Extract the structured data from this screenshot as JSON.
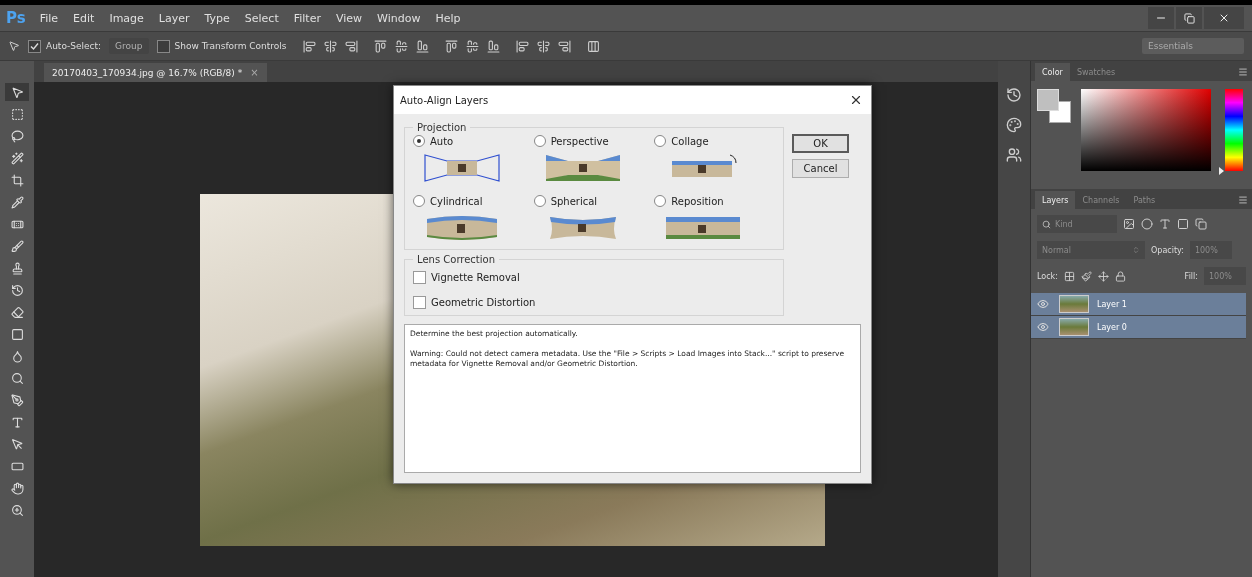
{
  "app": {
    "logo": "Ps"
  },
  "menu": [
    "File",
    "Edit",
    "Image",
    "Layer",
    "Type",
    "Select",
    "Filter",
    "View",
    "Window",
    "Help"
  ],
  "options_bar": {
    "auto_select": {
      "label": "Auto-Select:",
      "checked": true
    },
    "target": {
      "value": "Group",
      "disabled": true
    },
    "show_transform_controls": {
      "label": "Show Transform Controls",
      "checked": false
    },
    "workspace": "Essentials"
  },
  "document_tab": {
    "title": "20170403_170934.jpg @ 16.7% (RGB/8) *",
    "close": "×"
  },
  "color_panel": {
    "tabs": [
      {
        "label": "Color",
        "selected": true
      },
      {
        "label": "Swatches",
        "selected": false
      }
    ],
    "hue": {
      "level": 0
    }
  },
  "layers_panel": {
    "tabs": [
      {
        "label": "Layers",
        "selected": true
      },
      {
        "label": "Channels",
        "selected": false
      },
      {
        "label": "Paths",
        "selected": false
      }
    ],
    "filter": "Kind",
    "blend_mode": "Normal",
    "opacity_label": "Opacity:",
    "opacity": "100%",
    "lock_label": "Lock:",
    "fill_label": "Fill:",
    "fill": "100%",
    "layers": [
      {
        "name": "Layer 1",
        "visible": true,
        "selected": true
      },
      {
        "name": "Layer 0",
        "visible": true,
        "selected": true
      }
    ]
  },
  "dialog": {
    "title": "Auto-Align Layers",
    "projection": {
      "legend": "Projection",
      "options": [
        {
          "label": "Auto",
          "kind": "auto",
          "selected": true
        },
        {
          "label": "Perspective",
          "kind": "perspective",
          "selected": false
        },
        {
          "label": "Collage",
          "kind": "collage",
          "selected": false
        },
        {
          "label": "Cylindrical",
          "kind": "cylindrical",
          "selected": false
        },
        {
          "label": "Spherical",
          "kind": "spherical",
          "selected": false
        },
        {
          "label": "Reposition",
          "kind": "reposition",
          "selected": false
        }
      ]
    },
    "lens_correction": {
      "legend": "Lens Correction",
      "options": [
        {
          "label": "Vignette Removal",
          "checked": false
        },
        {
          "label": "Geometric Distortion",
          "checked": false
        }
      ]
    },
    "description": "Determine the best projection automatically.",
    "warning": "Warning: Could not detect camera metadata. Use the \"File > Scripts > Load Images into Stack...\" script to preserve metadata for Vignette Removal and/or Geometric Distortion.",
    "buttons": [
      {
        "label": "OK",
        "default": true
      },
      {
        "label": "Cancel",
        "default": false
      }
    ]
  }
}
